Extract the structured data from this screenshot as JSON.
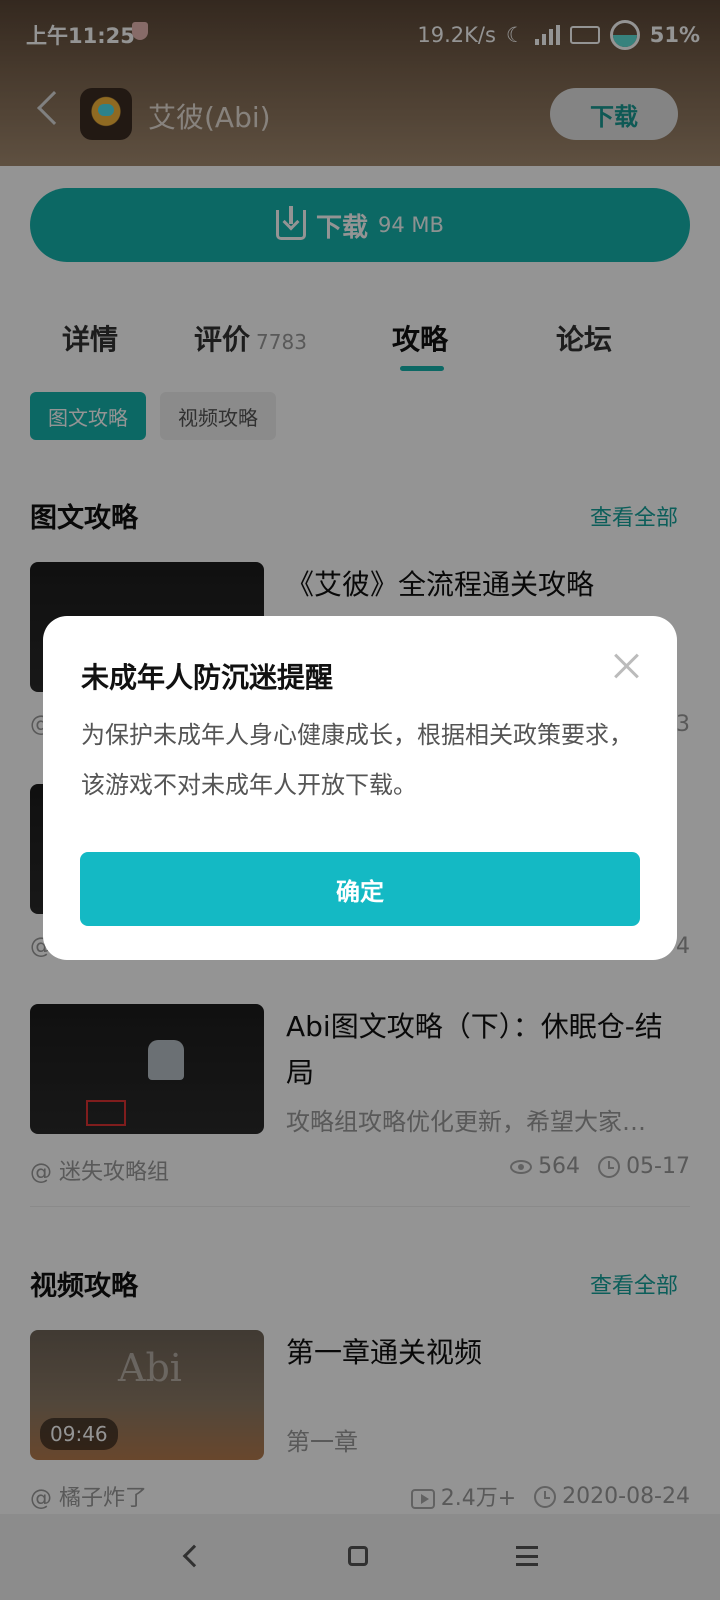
{
  "status_bar": {
    "time": "上午11:25",
    "net_speed": "19.2K/s",
    "battery": "51%"
  },
  "header": {
    "app_name": "艾彼(Abi)",
    "download_label": "下载"
  },
  "download_button": {
    "label": "下载",
    "size": "94 MB"
  },
  "tabs": [
    {
      "label": "详情"
    },
    {
      "label": "评价",
      "count": "7783"
    },
    {
      "label": "攻略"
    },
    {
      "label": "论坛"
    }
  ],
  "subtabs": [
    {
      "label": "图文攻略",
      "active": true
    },
    {
      "label": "视频攻略",
      "active": false
    }
  ],
  "text_section": {
    "title": "图文攻略",
    "see_all": "查看全部",
    "items": [
      {
        "title": "《艾彼》全流程通关攻略",
        "meta_right_partial": "3"
      },
      {
        "meta_right_partial": "4"
      },
      {
        "title": "Abi图文攻略（下）：休眠仓-结局",
        "desc": "攻略组攻略优化更新，希望大家…",
        "author": "@ 迷失攻略组",
        "views": "564",
        "date": "05-17"
      }
    ]
  },
  "video_section": {
    "title": "视频攻略",
    "see_all": "查看全部",
    "items": [
      {
        "title": "第一章通关视频",
        "subtitle": "第一章",
        "duration": "09:46",
        "thumb_text": "Abi",
        "author": "@ 橘子炸了",
        "plays": "2.4万+",
        "date": "2020-08-24"
      }
    ]
  },
  "dialog": {
    "title": "未成年人防沉迷提醒",
    "body": "为保护未成年人身心健康成长，根据相关政策要求，该游戏不对未成年人开放下载。",
    "confirm": "确定"
  },
  "colors": {
    "accent": "#16b3ad",
    "dialog_button": "#14b9c4"
  }
}
